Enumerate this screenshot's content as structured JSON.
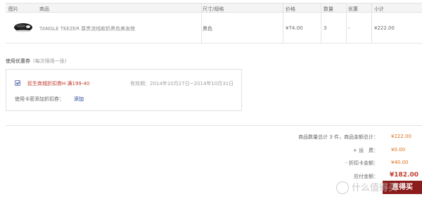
{
  "table": {
    "headers": {
      "image": "图片",
      "product": "商品",
      "spec": "尺寸/规格",
      "price": "价格",
      "quantity": "数量",
      "discount": "优惠",
      "subtotal": "小计"
    },
    "row": {
      "product_name": "TANGLE TEEZER 尊贵流线款奶黑色美发梳",
      "spec": "黑色",
      "price": "¥74.00",
      "quantity": "3",
      "discount": "-",
      "subtotal": "¥222.00"
    }
  },
  "coupon": {
    "title": "使用优惠券",
    "note": "(每次限用一张)",
    "name": "民生商城折扣券H 满199-40",
    "validity": "有效期：2014年10月27日~2014年10月31日",
    "card_label": "使用卡密添加折扣券：",
    "card_add": "添加"
  },
  "summary": {
    "count_total_label": "商品数量总计 3 件，商品金额总计：",
    "count_total_value": "¥222.00",
    "shipping_label": "+ 运　费：",
    "shipping_value": "¥0.00",
    "discount_label": "- 折扣卡金额：",
    "discount_value": "¥40.00",
    "payable_label": "应付金额：",
    "payable_value": "¥182.00"
  },
  "submit_label": "直得买",
  "watermark_text": "什么值得买",
  "colors": {
    "accent_red": "#c0392b",
    "amount_orange": "#e0701a",
    "button": "#8c1b1b",
    "link_blue": "#1b3c9a"
  }
}
